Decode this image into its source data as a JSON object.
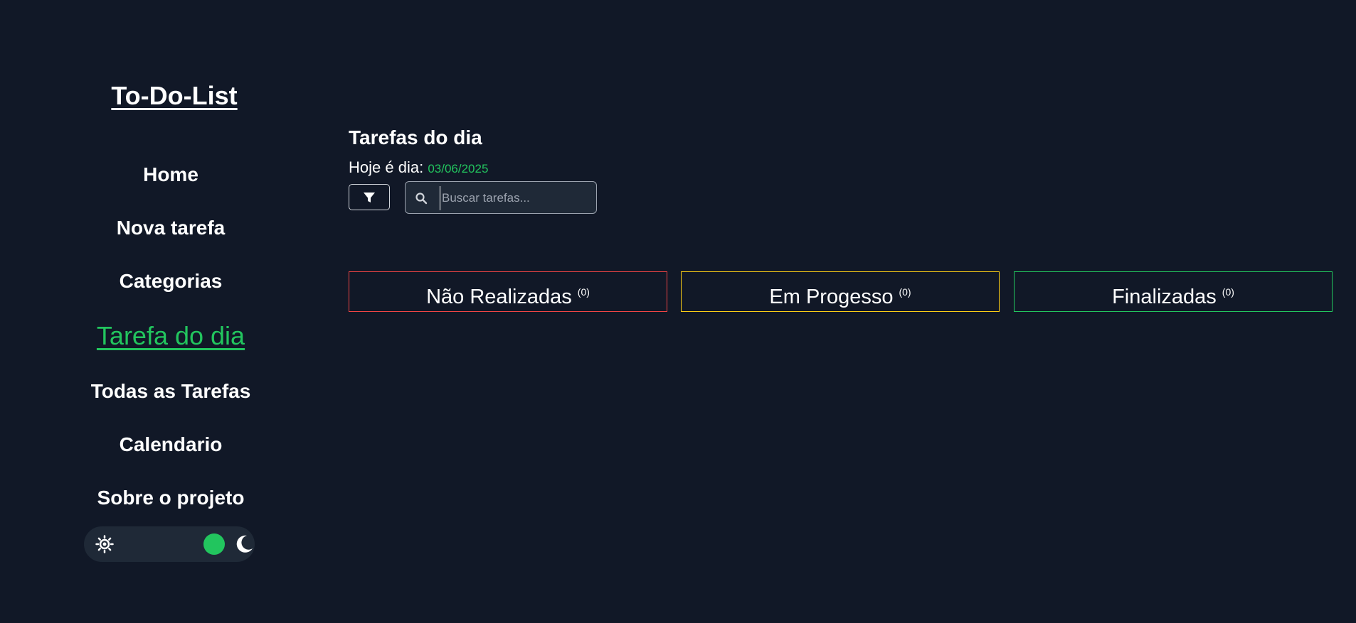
{
  "sidebar": {
    "app_title": "To-Do-List",
    "items": [
      {
        "label": "Home"
      },
      {
        "label": "Nova tarefa"
      },
      {
        "label": "Categorias"
      },
      {
        "label": "Tarefa do dia",
        "active": true
      },
      {
        "label": "Todas as Tarefas"
      },
      {
        "label": "Calendario"
      },
      {
        "label": "Sobre o projeto"
      }
    ],
    "theme_toggle": {
      "left_icon": "sun-icon",
      "right_icon": "moon-icon",
      "mode": "dark"
    }
  },
  "main": {
    "title": "Tarefas do dia",
    "date_label": "Hoje é dia:",
    "date_value": "03/06/2025",
    "filter_icon": "filter-icon",
    "search": {
      "placeholder": "Buscar tarefas...",
      "value": "",
      "icon": "search-icon"
    },
    "columns": [
      {
        "label": "Não Realizadas",
        "count": "(0)",
        "color": "#ef4444"
      },
      {
        "label": "Em Progesso",
        "count": "(0)",
        "color": "#facc15"
      },
      {
        "label": "Finalizadas",
        "count": "(0)",
        "color": "#22c55e"
      }
    ]
  },
  "colors": {
    "background": "#111827",
    "panel": "#1f2937",
    "accent": "#22c55e"
  }
}
